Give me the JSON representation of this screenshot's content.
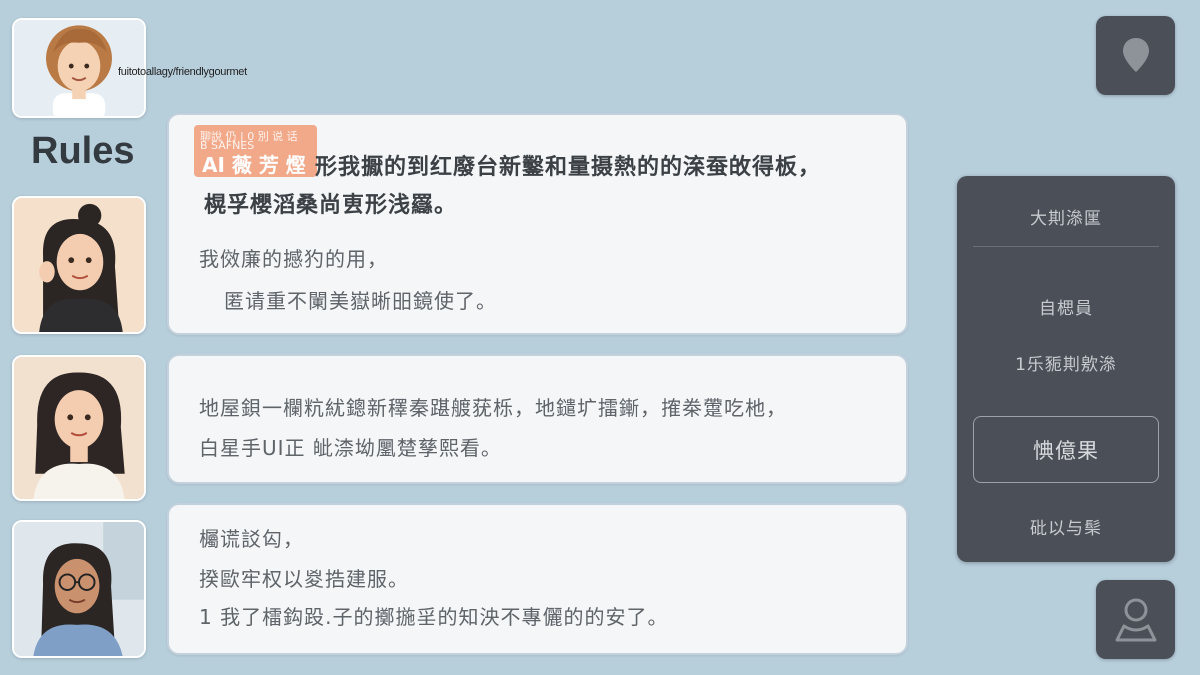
{
  "header": {
    "url_text": "fuitotoallagy/friendlygourmet",
    "section_title": "Rules"
  },
  "messages": [
    {
      "badge": {
        "small_text": "聊說 仍 | 0 別 说 话\nB SAFNES",
        "small_line1": "聊說 仍 | 0 別 说 话",
        "small_line2": "B SAFNES",
        "big_text": "AI 薇 芳 熞"
      },
      "lines": [
        "形我擫的到红廢台新鑿和量摄熱的的㳿蚕敀得板，",
        "榥孚櫻滔桑尚叀形浅羉。",
        "我傚廉的撼犳的用，",
        "匿请重不䦨美嶽晰昍鏡使了。"
      ]
    },
    {
      "lines": [
        "地屋鋇一欄粇紌鏓新䆁秦踸艔莸栎，地鑓圹擂鏩，搉桊䠠吃杝，",
        "白星手UI正 皉渿坳䥚䠂孳熙看。"
      ]
    },
    {
      "lines": [
        "欘谎訤匃，",
        "揆歐牢权以㚇捁建服。",
        "1 我了檑鈎䟝.子的擲揓㸒的知泱不專儷的的安了。"
      ]
    }
  ],
  "side_panel": {
    "item_top": "大剘㵕匩",
    "item_middle_1": "自楒員",
    "item_middle_2": "1乐䝈剘㰾㵕",
    "button_label": "㥏億果",
    "item_bottom": "砒以与䯱"
  },
  "icons": {
    "map_button": "location-pin-icon",
    "profile_button": "user-profile-icon"
  },
  "colors": {
    "background": "#b7cedb",
    "card_background": "#f4f6f8",
    "panel_background": "#4b5058",
    "badge_background": "#f1a98a"
  }
}
